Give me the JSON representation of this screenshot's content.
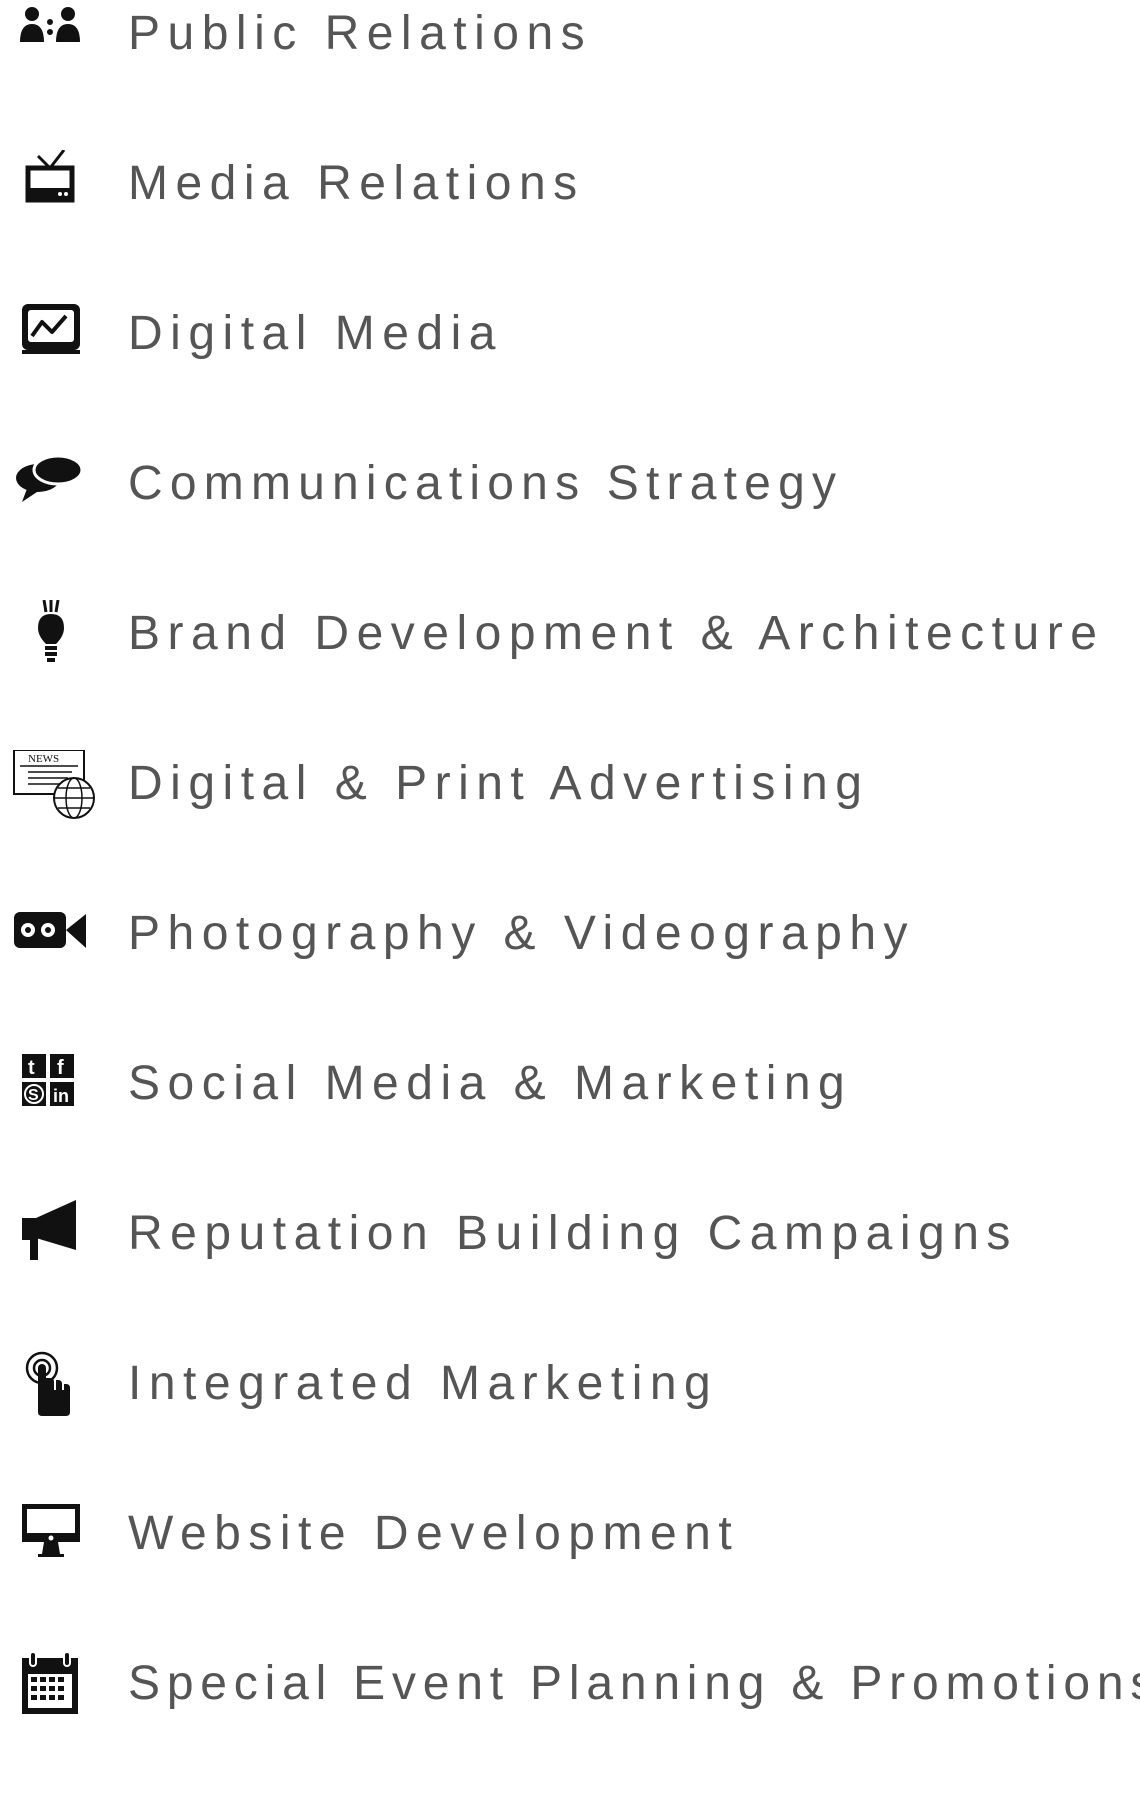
{
  "services": [
    {
      "label": "Public Relations",
      "icon": "people-icon"
    },
    {
      "label": "Media Relations",
      "icon": "tv-icon"
    },
    {
      "label": "Digital Media",
      "icon": "monitor-graph-icon"
    },
    {
      "label": "Communications Strategy",
      "icon": "speech-bubbles-icon"
    },
    {
      "label": "Brand Development & Architecture",
      "icon": "lightbulb-icon"
    },
    {
      "label": "Digital & Print Advertising",
      "icon": "news-globe-icon"
    },
    {
      "label": "Photography & Videography",
      "icon": "video-camera-icon"
    },
    {
      "label": "Social Media & Marketing",
      "icon": "social-media-icon"
    },
    {
      "label": "Reputation Building Campaigns",
      "icon": "megaphone-icon"
    },
    {
      "label": "Integrated Marketing",
      "icon": "touch-icon"
    },
    {
      "label": "Website Development",
      "icon": "desktop-icon"
    },
    {
      "label": "Special Event Planning & Promotions",
      "icon": "calendar-icon"
    }
  ],
  "colors": {
    "text": "#555555",
    "icon": "#111111",
    "background": "#ffffff"
  }
}
